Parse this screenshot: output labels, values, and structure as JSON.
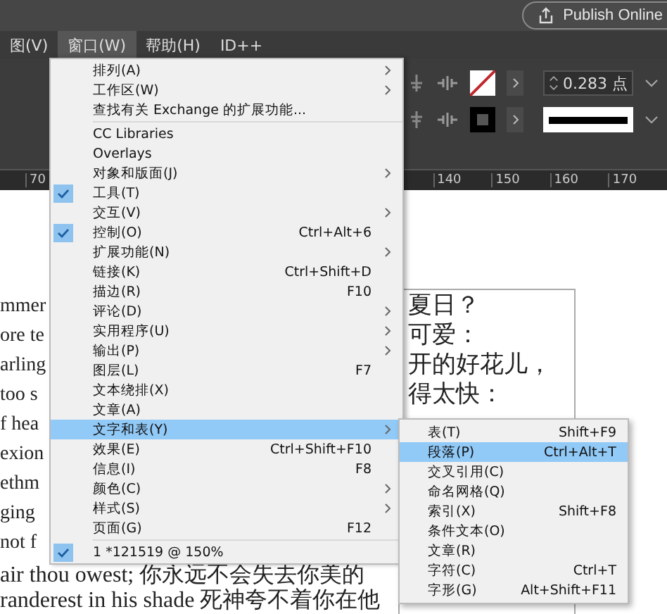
{
  "top_bar": {
    "publish_button": "Publish Online"
  },
  "menubar": [
    {
      "label": "图(V)",
      "selected": false
    },
    {
      "label": "窗口(W)",
      "selected": true
    },
    {
      "label": "帮助(H)",
      "selected": false
    },
    {
      "label": "ID++",
      "selected": false
    }
  ],
  "toolbar": {
    "stroke_weight": "0.283 点"
  },
  "ruler": [
    "70",
    "140",
    "150",
    "160",
    "170"
  ],
  "document": {
    "lines": [
      "mmer",
      "ore te",
      "arling",
      "too s",
      "f hea",
      "exion",
      "ethm",
      "ging",
      "not f",
      "air thou owest; 你永远不会失去你美的",
      "randerest in his shade 死神夸不着你在他"
    ],
    "frame_lines": [
      "夏日？",
      "可爱：",
      "开的好花儿，",
      "得太快："
    ]
  },
  "window_menu": [
    [
      {
        "label": "排列(A)",
        "submenu": true,
        "checked": false,
        "selected": false
      },
      {
        "label": "工作区(W)",
        "submenu": true,
        "checked": false,
        "selected": false
      },
      {
        "label": "查找有关 Exchange 的扩展功能...",
        "submenu": false,
        "checked": false,
        "selected": false
      }
    ],
    [
      {
        "label": "CC Libraries",
        "submenu": false,
        "checked": false,
        "selected": false
      },
      {
        "label": "Overlays",
        "submenu": false,
        "checked": false,
        "selected": false
      },
      {
        "label": "对象和版面(J)",
        "submenu": true,
        "checked": false,
        "selected": false
      },
      {
        "label": "工具(T)",
        "submenu": false,
        "checked": true,
        "selected": false
      },
      {
        "label": "交互(V)",
        "submenu": true,
        "checked": false,
        "selected": false
      },
      {
        "label": "控制(O)",
        "shortcut": "Ctrl+Alt+6",
        "submenu": false,
        "checked": true,
        "selected": false
      },
      {
        "label": "扩展功能(N)",
        "submenu": true,
        "checked": false,
        "selected": false
      },
      {
        "label": "链接(K)",
        "shortcut": "Ctrl+Shift+D",
        "submenu": false,
        "checked": false,
        "selected": false
      },
      {
        "label": "描边(R)",
        "shortcut": "F10",
        "submenu": false,
        "checked": false,
        "selected": false
      },
      {
        "label": "评论(D)",
        "submenu": true,
        "checked": false,
        "selected": false
      },
      {
        "label": "实用程序(U)",
        "submenu": true,
        "checked": false,
        "selected": false
      },
      {
        "label": "输出(P)",
        "submenu": true,
        "checked": false,
        "selected": false
      },
      {
        "label": "图层(L)",
        "shortcut": "F7",
        "submenu": false,
        "checked": false,
        "selected": false
      },
      {
        "label": "文本绕排(X)",
        "submenu": false,
        "checked": false,
        "selected": false
      },
      {
        "label": "文章(A)",
        "submenu": false,
        "checked": false,
        "selected": false
      },
      {
        "label": "文字和表(Y)",
        "submenu": true,
        "checked": false,
        "selected": true
      },
      {
        "label": "效果(E)",
        "shortcut": "Ctrl+Shift+F10",
        "submenu": false,
        "checked": false,
        "selected": false
      },
      {
        "label": "信息(I)",
        "shortcut": "F8",
        "submenu": false,
        "checked": false,
        "selected": false
      },
      {
        "label": "颜色(C)",
        "submenu": true,
        "checked": false,
        "selected": false
      },
      {
        "label": "样式(S)",
        "submenu": true,
        "checked": false,
        "selected": false
      },
      {
        "label": "页面(G)",
        "shortcut": "F12",
        "submenu": false,
        "checked": false,
        "selected": false
      }
    ],
    [
      {
        "label": "1 *121519 @ 150%",
        "submenu": false,
        "checked": true,
        "selected": false
      }
    ]
  ],
  "type_submenu": [
    {
      "label": "表(T)",
      "shortcut": "Shift+F9",
      "selected": false
    },
    {
      "label": "段落(P)",
      "shortcut": "Ctrl+Alt+T",
      "selected": true
    },
    {
      "label": "交叉引用(C)",
      "selected": false
    },
    {
      "label": "命名网格(Q)",
      "selected": false
    },
    {
      "label": "索引(X)",
      "shortcut": "Shift+F8",
      "selected": false
    },
    {
      "label": "条件文本(O)",
      "selected": false
    },
    {
      "label": "文章(R)",
      "selected": false
    },
    {
      "label": "字符(C)",
      "shortcut": "Ctrl+T",
      "selected": false
    },
    {
      "label": "字形(G)",
      "shortcut": "Alt+Shift+F11",
      "selected": false
    }
  ]
}
